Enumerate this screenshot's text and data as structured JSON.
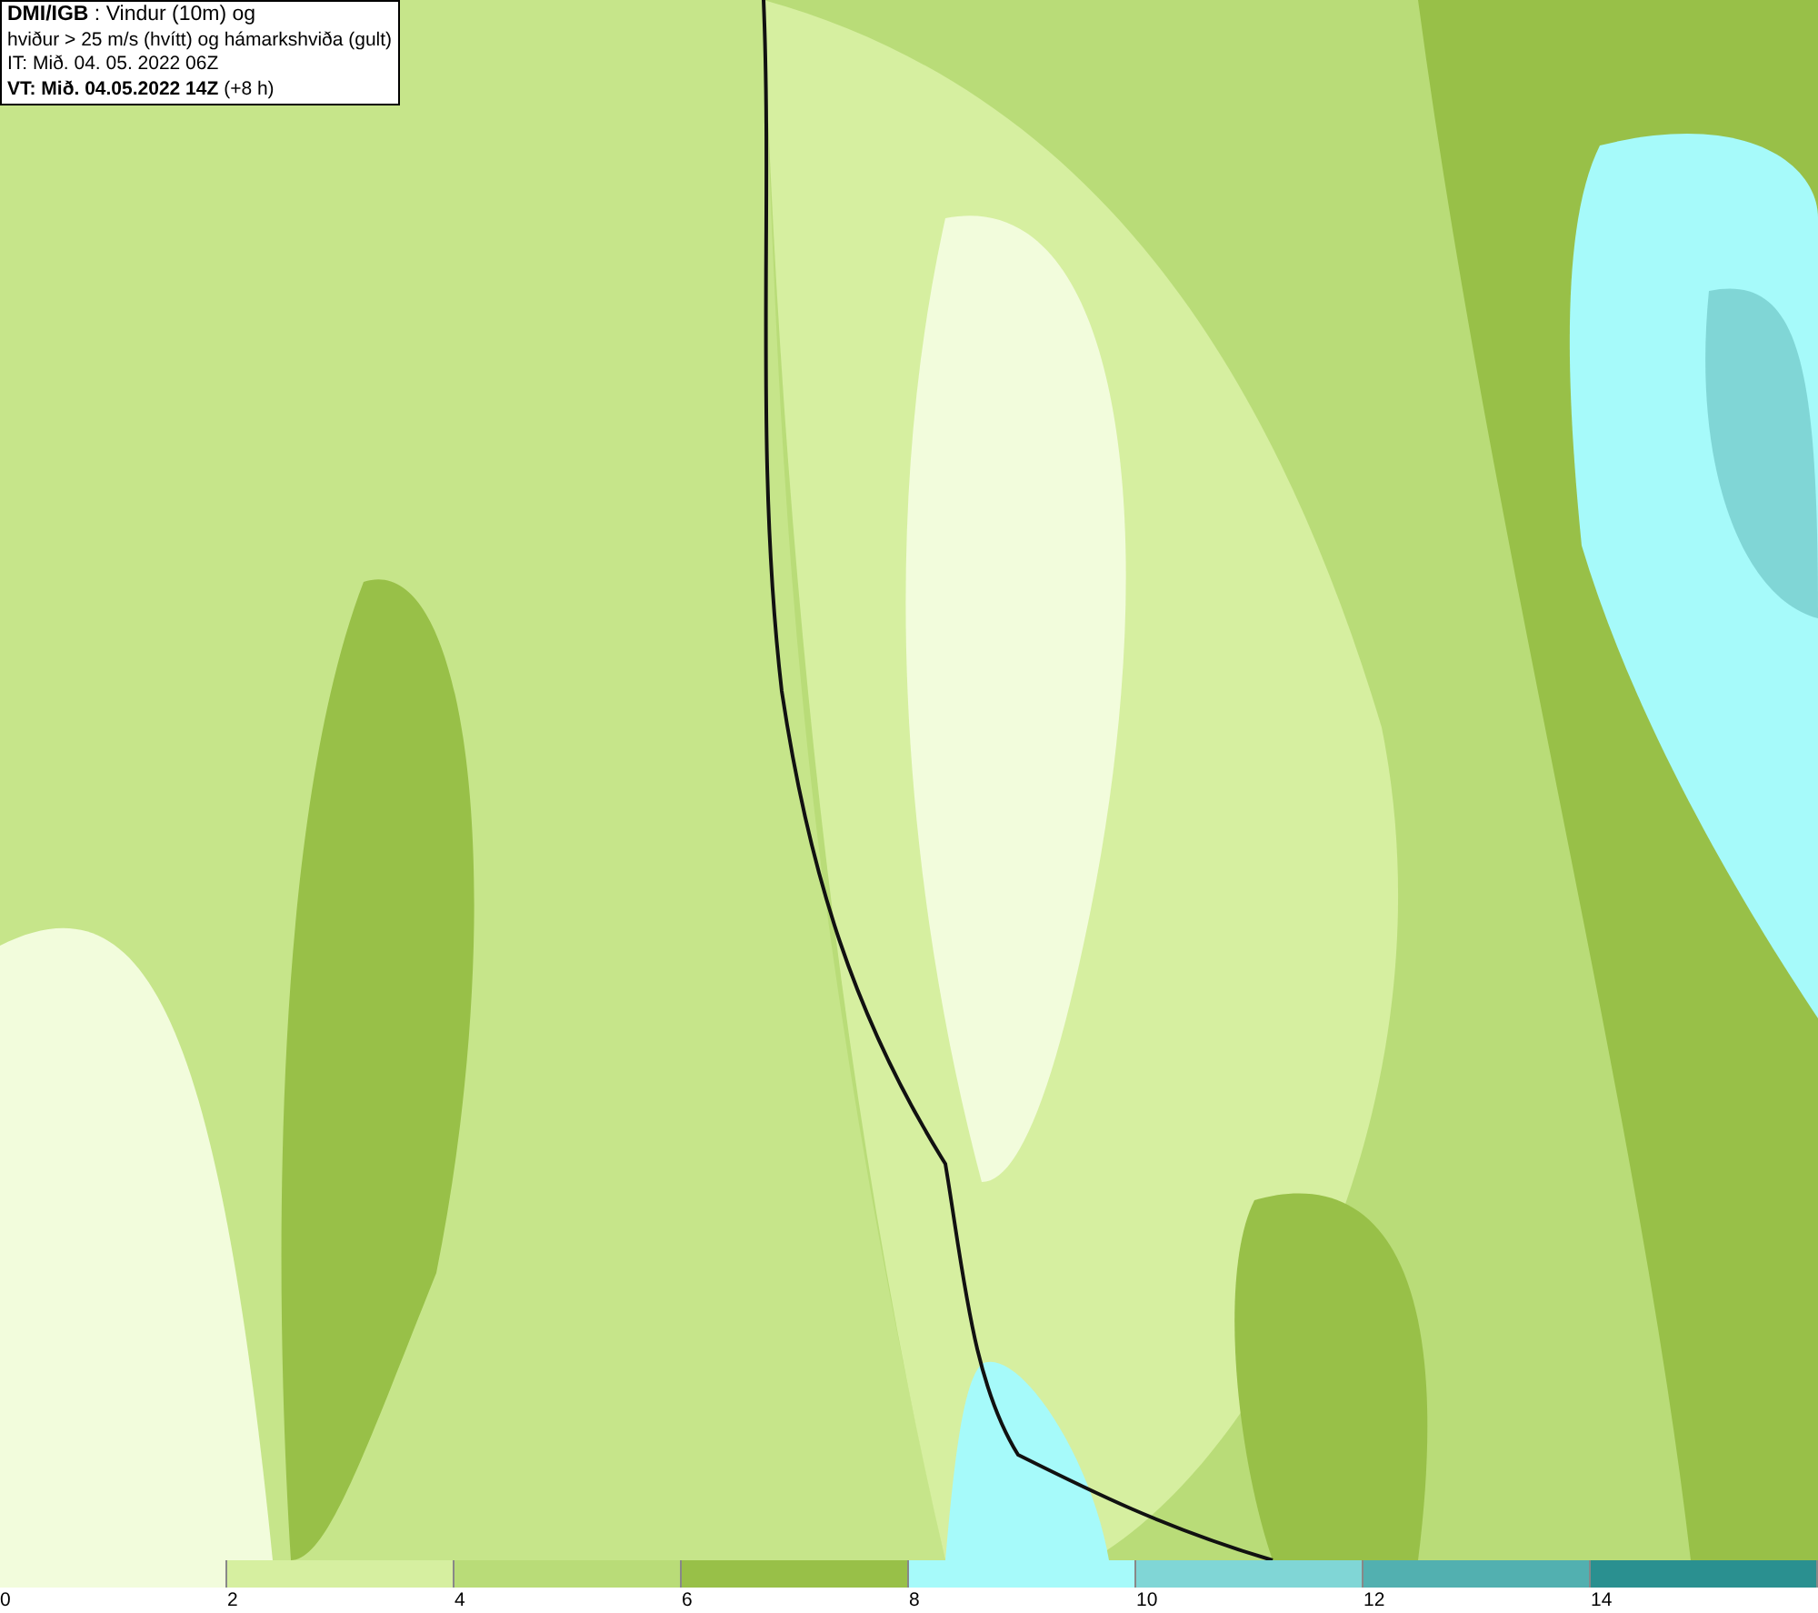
{
  "info_box": {
    "lines": [
      "**DMI/IGB** : Vindur (10m) og",
      "hviður > 25 m/s (hvítt) og hámarkshviða (gult)",
      "IT: Mið. 04. 05. 2022 06Z",
      "**VT: Mið. 04.05.2022 14Z** (+8 h)"
    ]
  },
  "legend": {
    "bins": [
      {
        "color": "#f2fcdc"
      },
      {
        "color": "#d6efa0"
      },
      {
        "color": "#b9dc78"
      },
      {
        "color": "#98c048"
      },
      {
        "color": "#a6fafa"
      },
      {
        "color": "#80d6d6"
      },
      {
        "color": "#52b0b0"
      },
      {
        "color": "#2a9090"
      }
    ],
    "ticks": [
      "0",
      "2",
      "4",
      "6",
      "8",
      "10",
      "12",
      "14"
    ]
  }
}
